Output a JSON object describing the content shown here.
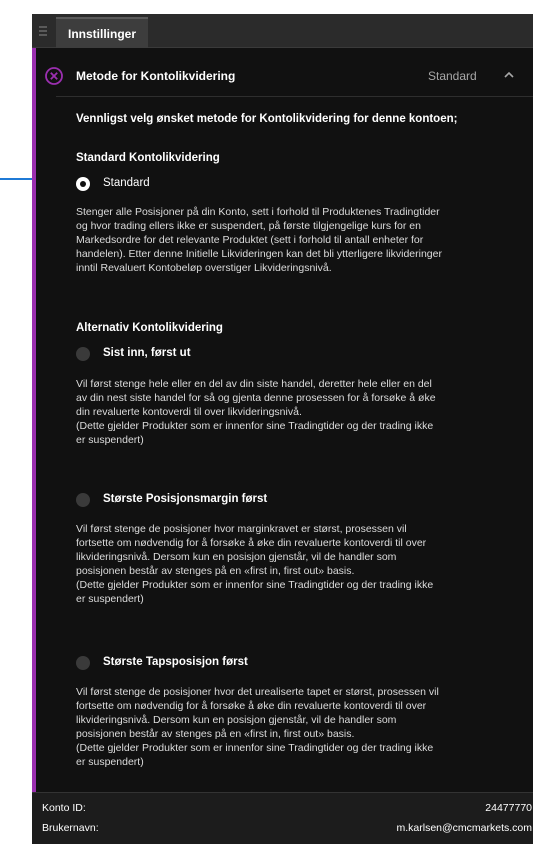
{
  "tab": {
    "label": "Innstillinger"
  },
  "section": {
    "title": "Metode for Kontolikvidering",
    "current_value": "Standard",
    "intro": "Vennligst velg ønsket metode for Kontolikvidering for denne kontoen;"
  },
  "standard_group": {
    "heading": "Standard Kontolikvidering",
    "option": {
      "label": "Standard",
      "selected": true,
      "description": "Stenger alle Posisjoner på din Konto, sett i forhold til Produktenes Tradingtider\nog hvor trading ellers ikke er suspendert, på første tilgjengelige kurs for en\nMarkedsordre for det relevante Produktet (sett i forhold til antall enheter for\nhandelen). Etter denne Initielle Likvideringen kan det bli ytterligere likvideringer\ninntil Revaluert Kontobeløp overstiger Likvideringsnivå."
    }
  },
  "alternative_group": {
    "heading": "Alternativ Kontolikvidering",
    "options": [
      {
        "label": "Sist inn, først ut",
        "selected": false,
        "description": "Vil først stenge hele eller en del av din siste handel, deretter hele eller en del\nav din nest siste handel for så og gjenta denne prosessen for å forsøke å øke\ndin revaluerte kontoverdi til over likvideringsnivå.\n(Dette gjelder Produkter som er innenfor sine Tradingtider og der trading ikke\ner suspendert)"
      },
      {
        "label": "Største Posisjonsmargin først",
        "selected": false,
        "description": "Vil først stenge de posisjoner hvor marginkravet er størst, prosessen vil\nfortsette om nødvendig for å forsøke å øke din revaluerte kontoverdi til over\nlikvideringsnivå. Dersom kun en posisjon gjenstår, vil de handler som\nposisjonen består av stenges på en «first in, first out» basis.\n(Dette gjelder Produkter som er innenfor sine Tradingtider og der trading ikke\ner suspendert)"
      },
      {
        "label": "Største Tapsposisjon først",
        "selected": false,
        "description": "Vil først stenge de posisjoner hvor det urealiserte tapet er størst, prosessen vil\nfortsette om nødvendig for å forsøke å øke din revaluerte kontoverdi til over\nlikvideringsnivå. Dersom kun en posisjon gjenstår, vil de handler som\nposisjonen består av stenges på en «first in, first out» basis.\n(Dette gjelder Produkter som er innenfor sine Tradingtider og der trading ikke\ner suspendert)"
      }
    ]
  },
  "footer": {
    "account_label": "Konto ID:",
    "account_value": "24477770",
    "user_label": "Brukernavn:",
    "user_value": "m.karlsen@cmcmarkets.com"
  },
  "colors": {
    "accent": "#9b2fb0",
    "callout": "#1f7ad6",
    "background": "#111111"
  },
  "icons": [
    "menu-icon",
    "close-icon",
    "chevron-up-icon",
    "radio-selected",
    "radio-unselected"
  ]
}
